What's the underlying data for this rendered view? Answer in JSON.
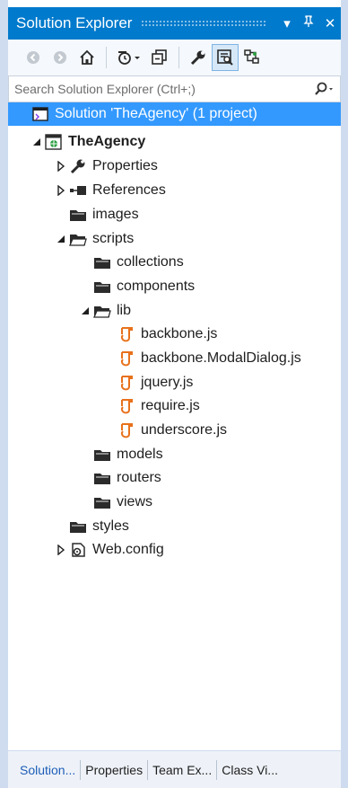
{
  "panel": {
    "title": "Solution Explorer",
    "dropdown_glyph": "▾",
    "pin_glyph": "ᵽ",
    "close_glyph": "✕"
  },
  "search": {
    "placeholder": "Search Solution Explorer (Ctrl+;)",
    "icon": "search-icon"
  },
  "tree": [
    {
      "label": "Solution 'TheAgency' (1 project)",
      "icon": "solution-icon",
      "selected": true
    },
    {
      "label": "TheAgency",
      "icon": "project-icon",
      "expanded": true,
      "bold": true
    },
    {
      "label": "Properties",
      "icon": "wrench-icon",
      "expanded": false
    },
    {
      "label": "References",
      "icon": "references-icon",
      "expanded": false
    },
    {
      "label": "images",
      "icon": "folder-icon"
    },
    {
      "label": "scripts",
      "icon": "folder-open-icon",
      "expanded": true
    },
    {
      "label": "collections",
      "icon": "folder-icon"
    },
    {
      "label": "components",
      "icon": "folder-icon"
    },
    {
      "label": "lib",
      "icon": "folder-open-icon",
      "expanded": true
    },
    {
      "label": "backbone.js",
      "icon": "js-file-icon"
    },
    {
      "label": "backbone.ModalDialog.js",
      "icon": "js-file-icon"
    },
    {
      "label": "jquery.js",
      "icon": "js-file-icon"
    },
    {
      "label": "require.js",
      "icon": "js-file-icon"
    },
    {
      "label": "underscore.js",
      "icon": "js-file-icon"
    },
    {
      "label": "models",
      "icon": "folder-icon"
    },
    {
      "label": "routers",
      "icon": "folder-icon"
    },
    {
      "label": "views",
      "icon": "folder-icon"
    },
    {
      "label": "styles",
      "icon": "folder-icon"
    },
    {
      "label": "Web.config",
      "icon": "config-file-icon",
      "expanded": false
    }
  ],
  "tabs": [
    {
      "label": "Solution...",
      "active": true
    },
    {
      "label": "Properties"
    },
    {
      "label": "Team Ex..."
    },
    {
      "label": "Class Vi..."
    }
  ],
  "colors": {
    "titlebar": "#007acc",
    "selection": "#3399ff",
    "js_icon": "#e8711c",
    "active_tab": "#1e5db8"
  }
}
